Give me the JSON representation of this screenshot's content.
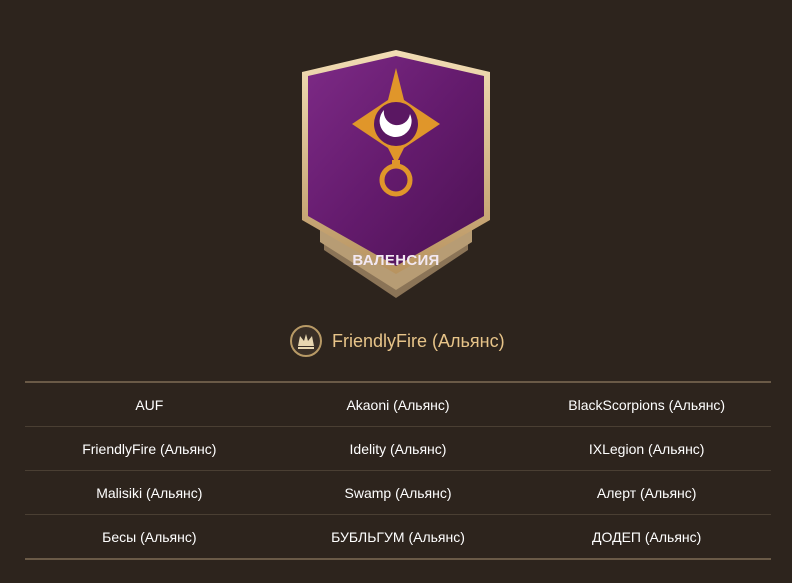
{
  "region": {
    "name": "ВАЛЕНСИЯ",
    "banner_color": "#6a1c72",
    "frame_color": "#d8bb8a",
    "sigil_color": "#e0962a"
  },
  "owner": {
    "icon": "crown-emblem-icon",
    "name": "FriendlyFire (Альянс)"
  },
  "alliances": {
    "rows": [
      [
        "AUF",
        "Akaoni (Альянс)",
        "BlackScorpions (Альянс)"
      ],
      [
        "FriendlyFire (Альянс)",
        "Idelity (Альянс)",
        "IXLegion (Альянс)"
      ],
      [
        "Malisiki (Альянс)",
        "Swamp (Альянс)",
        "Алерт (Альянс)"
      ],
      [
        "Бесы (Альянс)",
        "БУБЛЬГУМ (Альянс)",
        "ДОДЕП (Альянс)"
      ]
    ]
  }
}
